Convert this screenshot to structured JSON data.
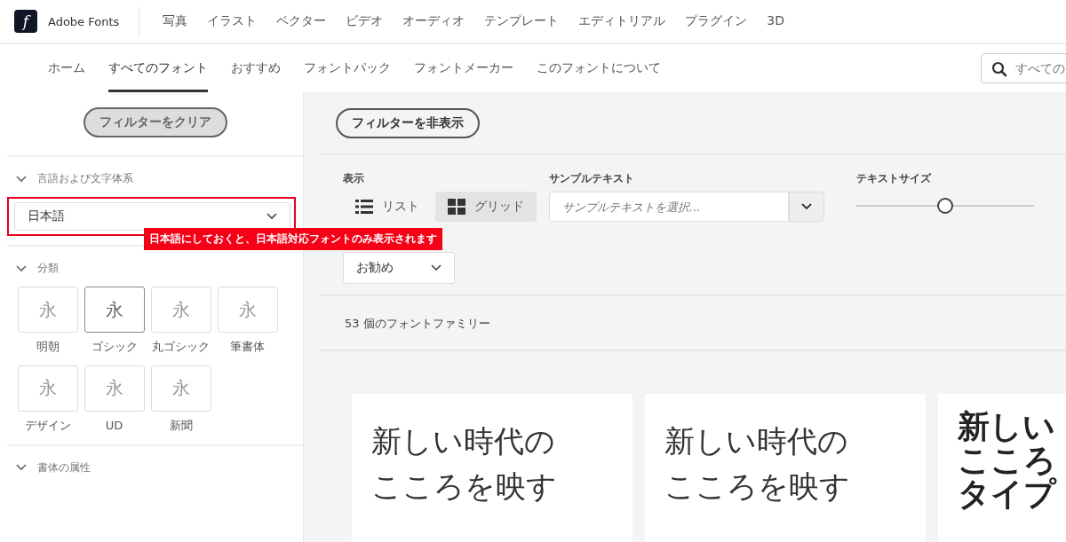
{
  "brand": {
    "logo_letter": "f",
    "name": "Adobe Fonts"
  },
  "top_nav": [
    "写真",
    "イラスト",
    "ベクター",
    "ビデオ",
    "オーディオ",
    "テンプレート",
    "エディトリアル",
    "プラグイン",
    "3D"
  ],
  "sub_nav": [
    {
      "label": "ホーム",
      "selected": false
    },
    {
      "label": "すべてのフォント",
      "selected": true
    },
    {
      "label": "おすすめ",
      "selected": false
    },
    {
      "label": "フォントパック",
      "selected": false
    },
    {
      "label": "フォントメーカー",
      "selected": false
    },
    {
      "label": "このフォントについて",
      "selected": false
    }
  ],
  "search": {
    "placeholder": "すべての"
  },
  "sidebar": {
    "clear_button": "フィルターをクリア",
    "language": {
      "heading": "言語および文字体系",
      "value": "日本語"
    },
    "classification": {
      "heading": "分類",
      "items": [
        {
          "glyph": "永",
          "label": "明朝",
          "selected": false
        },
        {
          "glyph": "永",
          "label": "ゴシック",
          "selected": true
        },
        {
          "glyph": "永",
          "label": "丸ゴシック",
          "selected": false
        },
        {
          "glyph": "永",
          "label": "筆書体",
          "selected": false
        },
        {
          "glyph": "永",
          "label": "デザイン",
          "selected": false
        },
        {
          "glyph": "永",
          "label": "UD",
          "selected": false
        },
        {
          "glyph": "永",
          "label": "新聞",
          "selected": false
        }
      ]
    },
    "properties": {
      "heading": "書体の属性"
    }
  },
  "annotation": "日本語にしておくと、日本語対応フォントのみ表示されます",
  "main": {
    "hide_filters_button": "フィルターを非表示",
    "view": {
      "label": "表示",
      "options": [
        {
          "kind": "list",
          "label": "リスト",
          "selected": false
        },
        {
          "kind": "grid",
          "label": "グリッド",
          "selected": true
        }
      ]
    },
    "sample_text": {
      "label": "サンプルテキスト",
      "placeholder": "サンプルテキストを選択..."
    },
    "text_size": {
      "label": "テキストサイズ",
      "level": 0.5
    },
    "sort": {
      "value": "お勧め"
    },
    "count": "53 個のフォントファミリー",
    "cards": [
      {
        "kind": "light",
        "lines": [
          "新しい時代の",
          "こころを映す"
        ]
      },
      {
        "kind": "light",
        "lines": [
          "新しい時代の",
          "こころを映す"
        ]
      },
      {
        "kind": "black",
        "lines": [
          "新しい",
          "こころ",
          "タイプ"
        ]
      }
    ]
  }
}
